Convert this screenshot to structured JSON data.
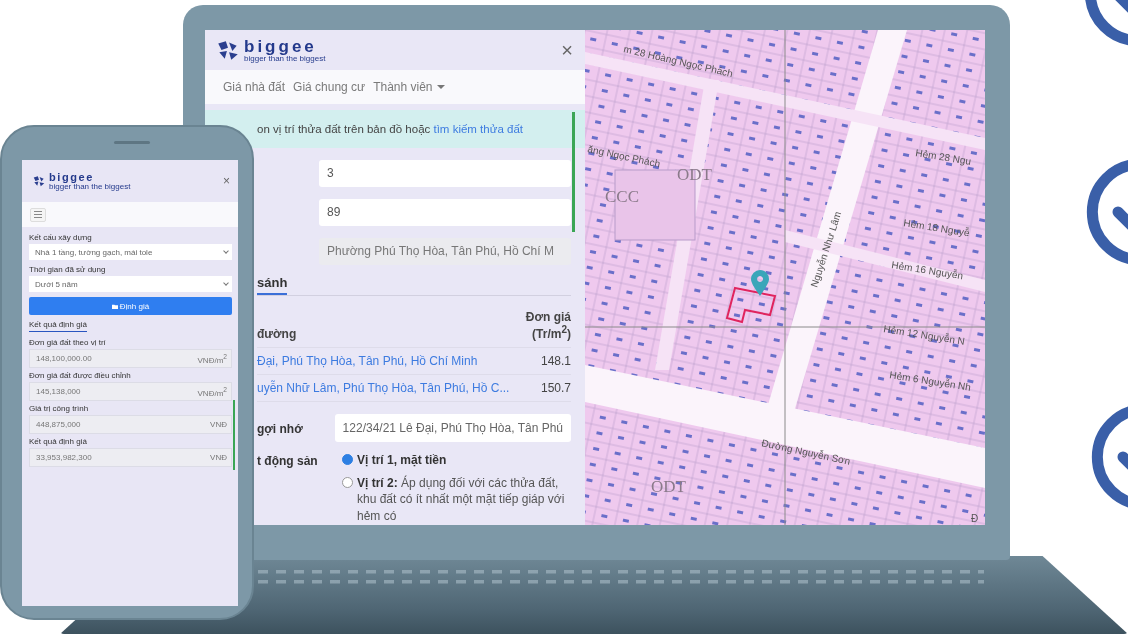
{
  "laptop": {
    "panel": {
      "logo": {
        "name": "biggee",
        "tagline": "bigger than the biggest"
      },
      "close": "×",
      "nav": [
        {
          "label": "Giá nhà đất",
          "dropdown": false
        },
        {
          "label": "Giá chung cư",
          "dropdown": false
        },
        {
          "label": "Thành viên",
          "dropdown": true
        }
      ],
      "notice": {
        "text": "on vị trí thửa đất trên bản đồ hoặc ",
        "link": "tìm kiếm thửa đất"
      },
      "fields": [
        {
          "value": "3",
          "readonly": false
        },
        {
          "value": "89",
          "readonly": false
        },
        {
          "value": "Phường Phú Thọ Hòa, Tân Phú, Hồ Chí M",
          "readonly": true
        }
      ],
      "tab": "sánh",
      "table": {
        "columns": [
          "đường",
          "Đơn giá (Tr/m$^{2}$)"
        ],
        "rows": [
          {
            "address": "Đại, Phú Thọ Hòa, Tân Phú, Hồ Chí Minh",
            "price": "148.1"
          },
          {
            "address": "uyễn Nhữ Lâm, Phú Thọ Hòa, Tân Phú, Hồ C...",
            "price": "150.7"
          }
        ]
      },
      "memo": {
        "label": "gợi nhớ",
        "value": "122/34/21 Lê Đại, Phú Thọ Hòa, Tân Phú"
      },
      "position": {
        "label": "t động sản",
        "options": [
          {
            "label": "Vị trí 1, mặt tiền",
            "selected": true
          },
          {
            "label": "Vị trí 2:",
            "description": " Áp dụng đối với các thửa đất, khu đất có ít nhất một mặt tiếp giáp với hẻm có",
            "selected": false
          }
        ]
      }
    },
    "map": {
      "labels": [
        {
          "text": "m 28 Hoàng Ngọc Phách",
          "kind": "street"
        },
        {
          "text": "ăng Ngọc Phách",
          "kind": "street"
        },
        {
          "text": "CCC",
          "kind": "zone"
        },
        {
          "text": "ODT",
          "kind": "zone"
        },
        {
          "text": "Hẻm 28 Ngu",
          "kind": "street"
        },
        {
          "text": "Hẻm 18 Nguyễ",
          "kind": "street"
        },
        {
          "text": "Hẻm 16 Nguyễn",
          "kind": "street"
        },
        {
          "text": "Nguyễn Như Lâm",
          "kind": "street"
        },
        {
          "text": "Hẻm 12 Nguyễn N",
          "kind": "street"
        },
        {
          "text": "Hẻm 6 Nguyễn Nh",
          "kind": "street"
        },
        {
          "text": "Đường Nguyễn Sơn",
          "kind": "street"
        },
        {
          "text": "ODT",
          "kind": "zone"
        },
        {
          "text": "Đ",
          "kind": "street"
        }
      ]
    }
  },
  "phone": {
    "logo": {
      "name": "biggee",
      "tagline": "bigger than the biggest"
    },
    "close": "×",
    "selects": [
      {
        "label": "Kết cấu xây dựng",
        "value": "Nhà 1 tầng, tường gạch, mái tole"
      },
      {
        "label": "Thời gian đã sử dụng",
        "value": "Dưới 5 năm"
      }
    ],
    "button": "Định giá",
    "tab": "Kết quả định giá",
    "results": [
      {
        "label": "Đơn giá đất theo vị trí",
        "value": "148,100,000.00",
        "unit": "VNĐ/m$^{2}$"
      },
      {
        "label": "Đơn giá đất được điều chỉnh",
        "value": "145,138,000",
        "unit": "VNĐ/m$^{2}$"
      },
      {
        "label": "Giá trị công trình",
        "value": "448,875,000",
        "unit": "VNĐ"
      },
      {
        "label": "Kết quả định giá",
        "value": "33,953,982,300",
        "unit": "VNĐ"
      }
    ]
  }
}
